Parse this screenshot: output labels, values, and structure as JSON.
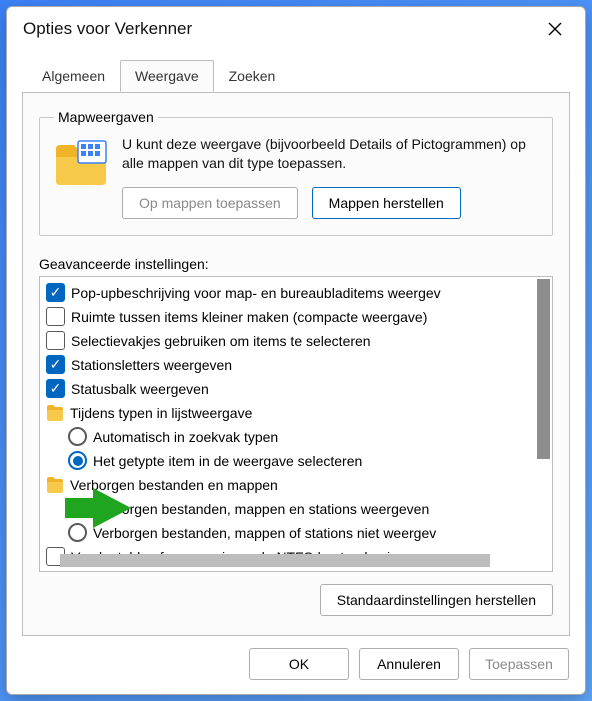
{
  "window": {
    "title": "Opties voor Verkenner"
  },
  "tabs": {
    "general": "Algemeen",
    "view": "Weergave",
    "search": "Zoeken"
  },
  "folderViews": {
    "legend": "Mapweergaven",
    "description": "U kunt deze weergave (bijvoorbeeld Details of Pictogrammen) op alle mappen van dit type toepassen.",
    "applyButton": "Op mappen toepassen",
    "resetButton": "Mappen herstellen"
  },
  "advanced": {
    "label": "Geavanceerde instellingen:",
    "items": [
      {
        "kind": "checkbox",
        "checked": true,
        "label": "Pop-upbeschrijving voor map- en bureaubladitems weergev",
        "indent": 0
      },
      {
        "kind": "checkbox",
        "checked": false,
        "label": "Ruimte tussen items kleiner maken (compacte weergave)",
        "indent": 0
      },
      {
        "kind": "checkbox",
        "checked": false,
        "label": "Selectievakjes gebruiken om items te selecteren",
        "indent": 0
      },
      {
        "kind": "checkbox",
        "checked": true,
        "label": "Stationsletters weergeven",
        "indent": 0
      },
      {
        "kind": "checkbox",
        "checked": true,
        "label": "Statusbalk weergeven",
        "indent": 0
      },
      {
        "kind": "folder",
        "label": "Tijdens typen in lijstweergave",
        "indent": 0
      },
      {
        "kind": "radio",
        "checked": false,
        "label": "Automatisch in zoekvak typen",
        "indent": 1
      },
      {
        "kind": "radio",
        "checked": true,
        "label": "Het getypte item in de weergave selecteren",
        "indent": 1
      },
      {
        "kind": "folder",
        "label": "Verborgen bestanden en mappen",
        "indent": 0
      },
      {
        "kind": "radio",
        "checked": true,
        "label": "Verborgen bestanden, mappen en stations weergeven",
        "indent": 1
      },
      {
        "kind": "radio",
        "checked": false,
        "label": "Verborgen bestanden, mappen of stations niet weergev",
        "indent": 1
      },
      {
        "kind": "checkbox",
        "checked": false,
        "label": "Versleutelde of gecomprimeerde NTFS-bestanden in een a",
        "indent": 0
      }
    ]
  },
  "restoreDefaults": "Standaardinstellingen herstellen",
  "dialogButtons": {
    "ok": "OK",
    "cancel": "Annuleren",
    "apply": "Toepassen"
  }
}
